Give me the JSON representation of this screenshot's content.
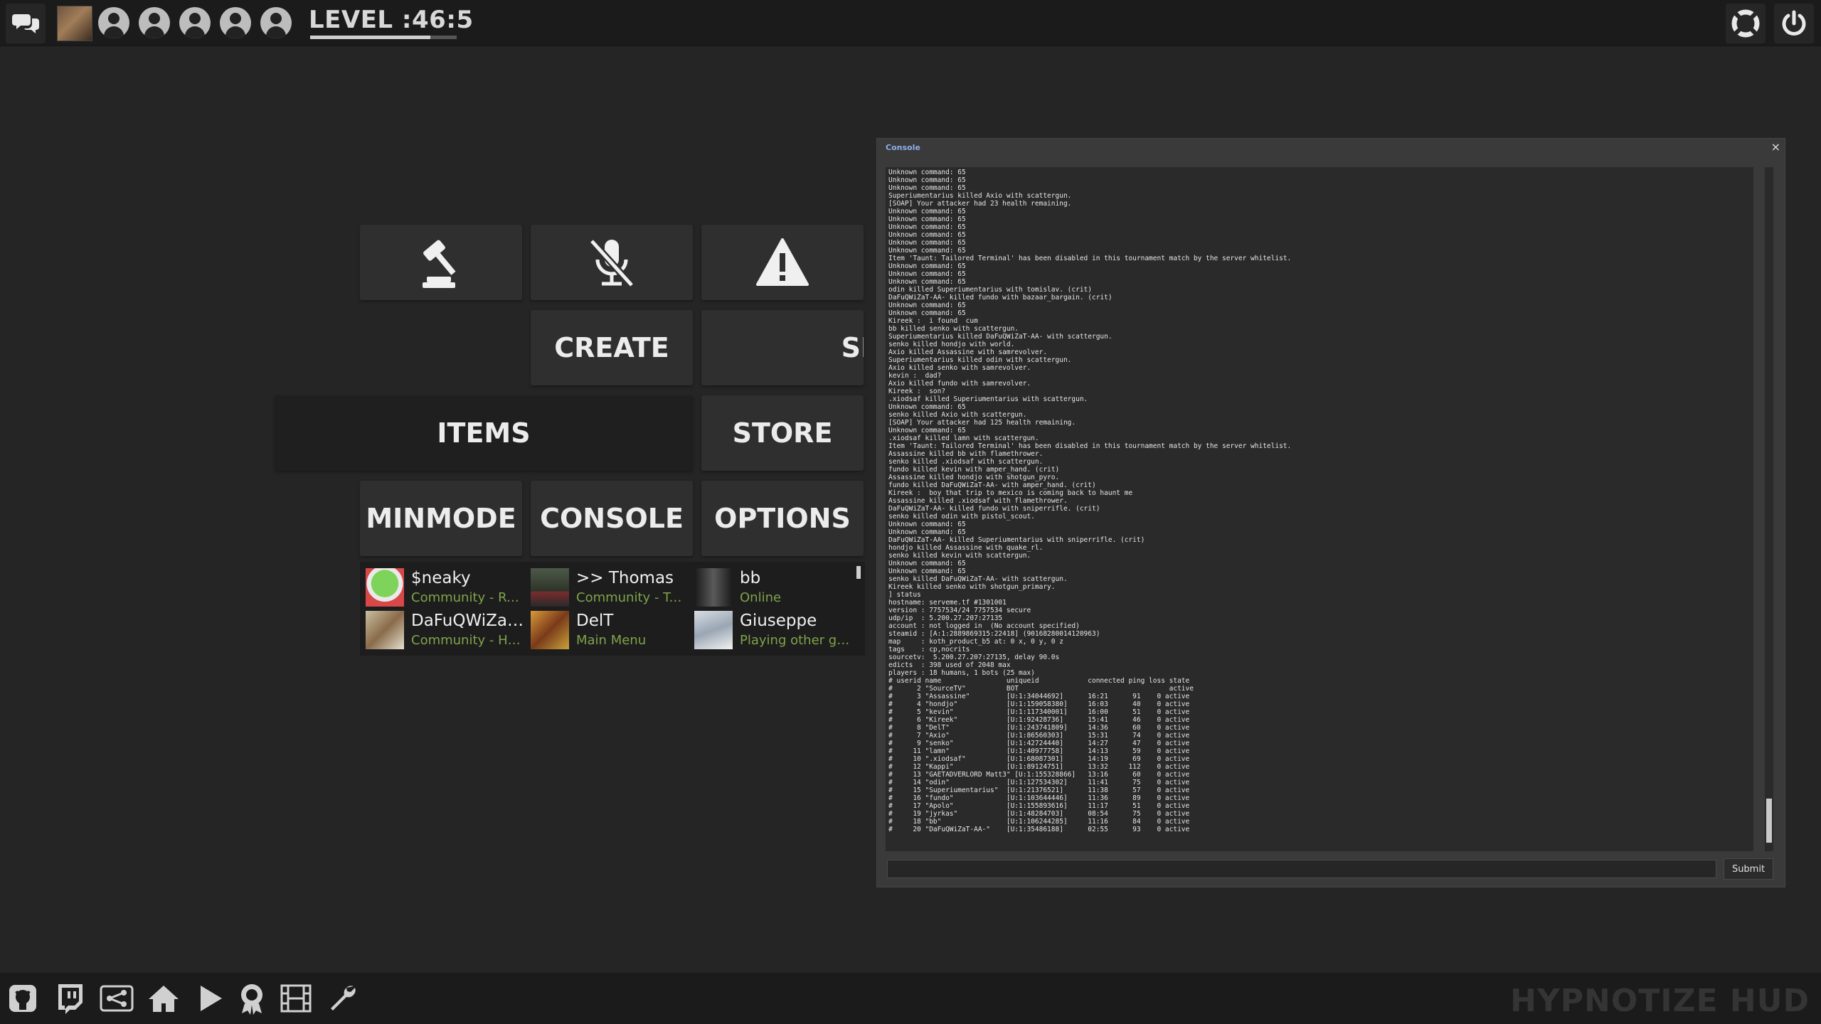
{
  "topbar": {
    "level_text": "LEVEL :46:5",
    "level_progress": 0.82,
    "chat_icon": "chat-bubbles-icon",
    "friend_slot_icons": [
      "user-icon",
      "user-icon",
      "user-icon",
      "user-icon",
      "user-icon"
    ],
    "right_icons": [
      "lifebuoy-icon",
      "power-icon"
    ]
  },
  "menu": {
    "create_label": "CREATE",
    "server_label_partial": "SE",
    "items_label": "ITEMS",
    "store_label": "STORE",
    "minmode_label": "MINMODE",
    "console_label": "CONSOLE",
    "options_label": "OPTIONS",
    "icon_buttons": [
      "gavel-icon",
      "mic-mute-icon",
      "warning-icon"
    ]
  },
  "friends": [
    {
      "name": "$neaky",
      "status": "Community - Rec..."
    },
    {
      "name": ">> Thomas",
      "status": "Community - Turb..."
    },
    {
      "name": "bb",
      "status": "Online"
    },
    {
      "name": "DaFuQWiZaT...",
      "status": "Community - Hig..."
    },
    {
      "name": "DelT",
      "status": "Main Menu"
    },
    {
      "name": "Giuseppe",
      "status": "Playing other game"
    }
  ],
  "console": {
    "title": "Console",
    "close_glyph": "×",
    "submit_label": "Submit",
    "log": "Unknown command: 65\nUnknown command: 65\nUnknown command: 65\nSuperiumentarius killed Axio with scattergun.\n[SOAP] Your attacker had 23 health remaining.\nUnknown command: 65\nUnknown command: 65\nUnknown command: 65\nUnknown command: 65\nUnknown command: 65\nUnknown command: 65\nItem 'Taunt: Tailored Terminal' has been disabled in this tournament match by the server whitelist.\nUnknown command: 65\nUnknown command: 65\nUnknown command: 65\nodin killed Superiumentarius with tomislav. (crit)\nDaFuQWiZaT-AA- killed fundo with bazaar_bargain. (crit)\nUnknown command: 65\nUnknown command: 65\nKireek :  i found  cum\nbb killed senko with scattergun.\nSuperiumentarius killed DaFuQWiZaT-AA- with scattergun.\nsenko killed hondjo with world.\nAxio killed Assassine with samrevolver.\nSuperiumentarius killed odin with scattergun.\nAxio killed senko with samrevolver.\nkevin :  dad?\nAxio killed fundo with samrevolver.\nKireek :  son?\n.xiodsaf killed Superiumentarius with scattergun.\nUnknown command: 65\nsenko killed Axio with scattergun.\n[SOAP] Your attacker had 125 health remaining.\nUnknown command: 65\n.xiodsaf killed lamn with scattergun.\nItem 'Taunt: Tailored Terminal' has been disabled in this tournament match by the server whitelist.\nAssassine killed bb with flamethrower.\nsenko killed .xiodsaf with scattergun.\nfundo killed kevin with amper_hand. (crit)\nAssassine killed hondjo with shotgun_pyro.\nfundo killed DaFuQWiZaT-AA- with amper_hand. (crit)\nKireek :  boy that trip to mexico is coming back to haunt me\nAssassine killed .xiodsaf with flamethrower.\nDaFuQWiZaT-AA- killed fundo with sniperrifle. (crit)\nsenko killed odin with pistol_scout.\nUnknown command: 65\nUnknown command: 65\nDaFuQWiZaT-AA- killed Superiumentarius with sniperrifle. (crit)\nhondjo killed Assassine with quake_rl.\nsenko killed kevin with scattergun.\nUnknown command: 65\nUnknown command: 65\nsenko killed DaFuQWiZaT-AA- with scattergun.\nKireek killed senko with shotgun_primary.\n] status\nhostname: serveme.tf #1301001\nversion : 7757534/24 7757534 secure\nudp/ip  : 5.200.27.207:27135\naccount : not logged in  (No account specified)\nsteamid : [A:1:2889869315:22418] (90168280014120963)\nmap     : koth_product_b5 at: 0 x, 0 y, 0 z\ntags    : cp,nocrits\nsourcetv:  5.200.27.207:27135, delay 90.0s\nedicts  : 398 used of 2048 max\nplayers : 18 humans, 1 bots (25 max)\n# userid name                uniqueid            connected ping loss state\n#      2 \"SourceTV\"          BOT                                     active\n#      3 \"Assassine\"         [U:1:34044692]      16:21      91    0 active\n#      4 \"hondjo\"            [U:1:159058380]     16:03      40    0 active\n#      5 \"kevin\"             [U:1:117340001]     16:00      51    0 active\n#      6 \"Kireek\"            [U:1:92428736]      15:41      46    0 active\n#      8 \"DelT\"              [U:1:243741809]     14:36      60    0 active\n#      7 \"Axio\"              [U:1:86560303]      15:31      74    0 active\n#      9 \"senko\"             [U:1:42724440]      14:27      47    0 active\n#     11 \"lamn\"              [U:1:40977758]      14:13      59    0 active\n#     10 \".xiodsaf\"          [U:1:68087301]      14:19      69    0 active\n#     12 \"Kappi\"             [U:1:89124751]      13:32     112    0 active\n#     13 \"GAETADVERLORD Matt3\" [U:1:155328866]   13:16      60    0 active\n#     14 \"odin\"              [U:1:127534302]     11:41      75    0 active\n#     15 \"Superiumentarius\"  [U:1:21376521]      11:38      57    0 active\n#     16 \"fundo\"             [U:1:103644446]     11:36      89    0 active\n#     17 \"Apolo\"             [U:1:155893616]     11:17      51    0 active\n#     19 \"jyrkas\"            [U:1:48284703]      08:54      75    0 active\n#     18 \"bb\"                [U:1:106244285]     11:16      84    0 active\n#     20 \"DaFuQWiZaT-AA-\"    [U:1:35486188]      02:55      93    0 active"
  },
  "bottombar": {
    "icons": [
      "github-icon",
      "twitch-icon",
      "share-icon",
      "home-icon",
      "play-icon",
      "achievement-icon",
      "film-icon",
      "wrench-icon"
    ],
    "brand": "HYPNOTIZE HUD"
  }
}
